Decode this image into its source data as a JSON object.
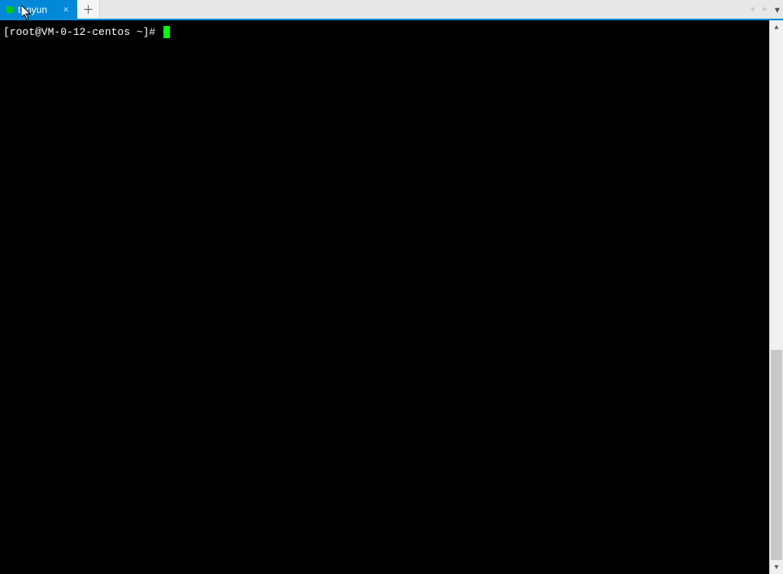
{
  "tabs": {
    "active": {
      "label": "tenyun",
      "close_glyph": "×"
    },
    "add_glyph": "＋"
  },
  "nav": {
    "left_glyph": "◀",
    "right_glyph": "▶",
    "dropdown_glyph": "▾"
  },
  "terminal": {
    "prompt": "[root@VM-0-12-centos ~]# "
  },
  "scrollbar": {
    "up_glyph": "▲",
    "down_glyph": "▼"
  },
  "colors": {
    "tab_active_bg": "#0088d8",
    "status_connected": "#00d000",
    "terminal_bg": "#000000",
    "terminal_fg": "#ffffff",
    "cursor": "#00ff00"
  }
}
